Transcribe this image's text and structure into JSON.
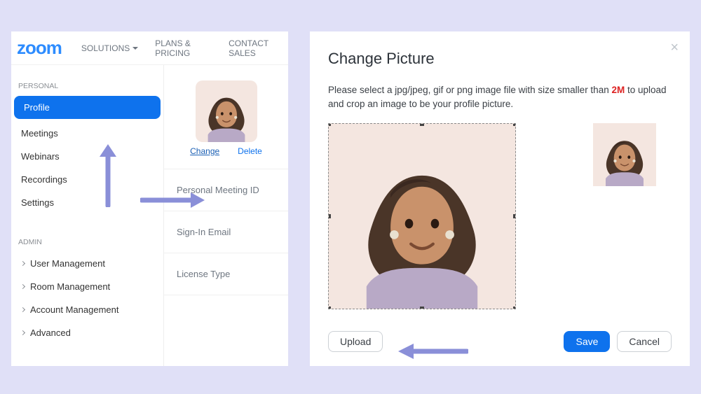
{
  "topnav": {
    "logo": "zoom",
    "solutions": "SOLUTIONS",
    "plans": "PLANS & PRICING",
    "contact": "CONTACT SALES"
  },
  "sidebar": {
    "personal_label": "PERSONAL",
    "admin_label": "ADMIN",
    "personal": [
      {
        "label": "Profile",
        "active": true
      },
      {
        "label": "Meetings"
      },
      {
        "label": "Webinars"
      },
      {
        "label": "Recordings"
      },
      {
        "label": "Settings"
      }
    ],
    "admin": [
      {
        "label": "User Management"
      },
      {
        "label": "Room Management"
      },
      {
        "label": "Account Management"
      },
      {
        "label": "Advanced"
      }
    ]
  },
  "profile": {
    "change": "Change",
    "delete": "Delete",
    "rows": [
      "Personal Meeting ID",
      "Sign-In Email",
      "License Type"
    ]
  },
  "modal": {
    "title": "Change Picture",
    "desc_pre": "Please select a jpg/jpeg, gif or png image file with size smaller than ",
    "size_limit": "2M",
    "desc_post": " to upload and crop an image to be your profile picture.",
    "upload": "Upload",
    "save": "Save",
    "cancel": "Cancel"
  },
  "colors": {
    "primary": "#0e72ed",
    "arrow": "#8a8fd8"
  }
}
